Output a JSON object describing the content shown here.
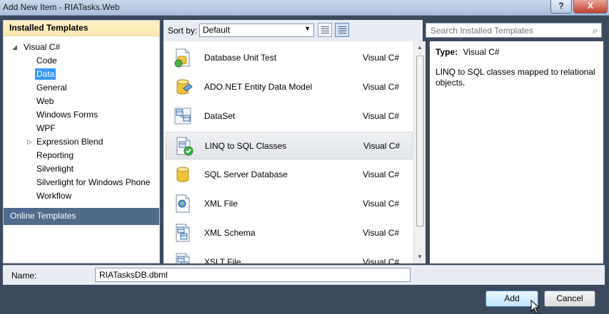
{
  "window": {
    "title": "Add New Item - RIATasks.Web",
    "help_label": "?",
    "close_label": "X"
  },
  "left_pane": {
    "installed_header": "Installed Templates",
    "tree": [
      {
        "label": "Visual C#",
        "level": 0,
        "expander": "expanded"
      },
      {
        "label": "Code",
        "level": 1
      },
      {
        "label": "Data",
        "level": 1,
        "selected": true
      },
      {
        "label": "General",
        "level": 1
      },
      {
        "label": "Web",
        "level": 1
      },
      {
        "label": "Windows Forms",
        "level": 1
      },
      {
        "label": "WPF",
        "level": 1
      },
      {
        "label": "Expression Blend",
        "level": 1,
        "expander": "collapsed"
      },
      {
        "label": "Reporting",
        "level": 1
      },
      {
        "label": "Silverlight",
        "level": 1
      },
      {
        "label": "Silverlight for Windows Phone",
        "level": 1
      },
      {
        "label": "Workflow",
        "level": 1
      }
    ],
    "online_templates": "Online Templates"
  },
  "sort": {
    "label": "Sort by:",
    "selected": "Default"
  },
  "search": {
    "placeholder": "Search Installed Templates"
  },
  "templates": [
    {
      "name": "Database Unit Test",
      "language": "Visual C#",
      "icon": "database-unit-test-icon"
    },
    {
      "name": "ADO.NET Entity Data Model",
      "language": "Visual C#",
      "icon": "entity-data-model-icon"
    },
    {
      "name": "DataSet",
      "language": "Visual C#",
      "icon": "dataset-icon"
    },
    {
      "name": "LINQ to SQL Classes",
      "language": "Visual C#",
      "icon": "linq-to-sql-icon",
      "selected": true
    },
    {
      "name": "SQL Server Database",
      "language": "Visual C#",
      "icon": "sql-database-icon"
    },
    {
      "name": "XML File",
      "language": "Visual C#",
      "icon": "xml-file-icon"
    },
    {
      "name": "XML Schema",
      "language": "Visual C#",
      "icon": "xml-schema-icon"
    },
    {
      "name": "XSLT File",
      "language": "Visual C#",
      "icon": "xslt-file-icon"
    }
  ],
  "details": {
    "type_label": "Type:",
    "type_value": "Visual C#",
    "description": "LINQ to SQL classes mapped to relational objects."
  },
  "bottom": {
    "name_label": "Name:",
    "name_value": "RIATasksDB.dbml"
  },
  "buttons": {
    "add": "Add",
    "cancel": "Cancel"
  }
}
